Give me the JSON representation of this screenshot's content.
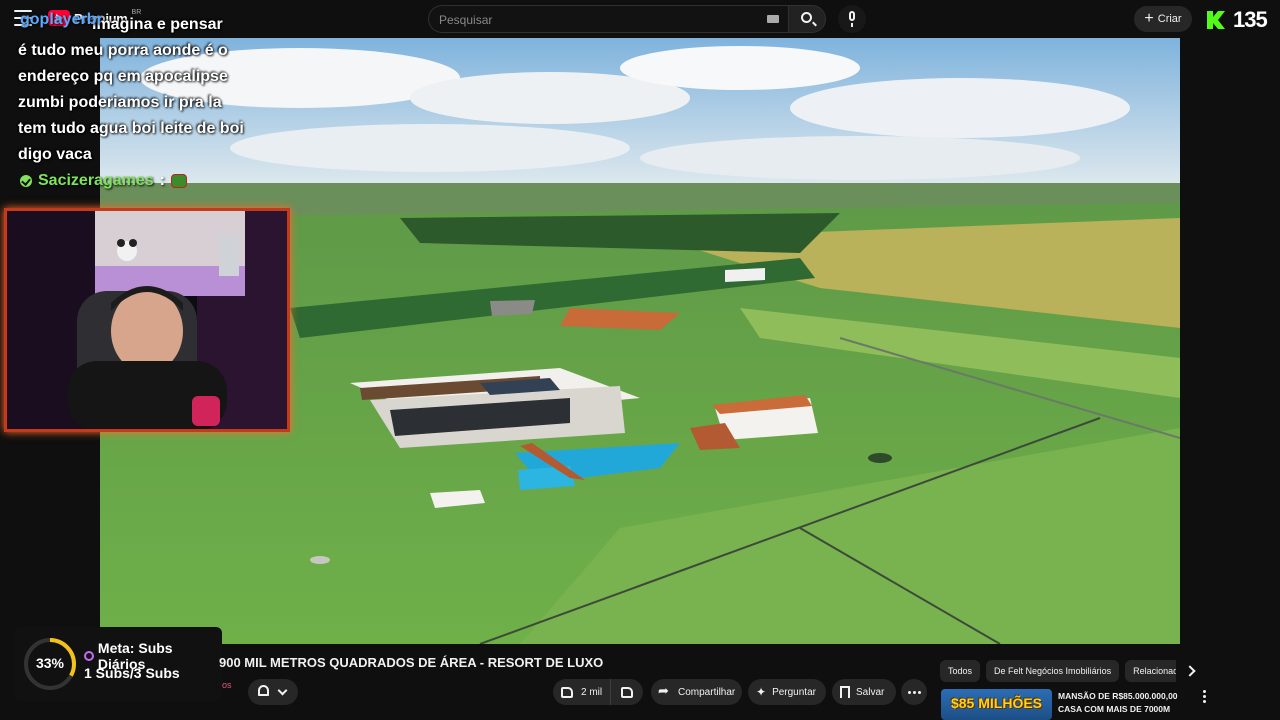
{
  "header": {
    "logo_text": "Premium",
    "logo_region": "BR",
    "search_placeholder": "Pesquisar",
    "create_label": "Criar",
    "k_count": "135"
  },
  "chat": {
    "username": "goplayerbr",
    "message_lines": [
      "imagina e pensar",
      "é tudo meu porra aonde é o",
      "endereço pq em apocalipse",
      "zumbi poderiamos ir pra la",
      "tem tudo agua boi leite de boi",
      "digo vaca"
    ],
    "next_username": "Sacizeragames",
    "next_separator": ":"
  },
  "goal": {
    "percent_label": "33%",
    "percent_value": 33,
    "title": "Meta: Subs Diários",
    "progress": "1 Subs/3 Subs"
  },
  "video": {
    "title": "900 MIL METROS QUADRADOS DE ÁREA - RESORT DE LUXO",
    "channel_fragment": "os",
    "like_count": "2 mil",
    "share_label": "Compartilhar",
    "ask_label": "Perguntar",
    "save_label": "Salvar"
  },
  "sidebar": {
    "chips": [
      "Todos",
      "De Felt Negócios Imobiliários",
      "Relacionados"
    ],
    "recommendation": {
      "thumb_text": "$85 MILHÕES",
      "title": "MANSÃO DE R$85.000.000,00 CASA COM MAIS DE 7000M"
    }
  },
  "colors": {
    "background": "#0f0f0f",
    "chat_username": "#5aa9ff",
    "chat_next_username": "#7fe35c",
    "goal_ring": "#f2c21b",
    "webcam_border": "#c43a1a"
  }
}
